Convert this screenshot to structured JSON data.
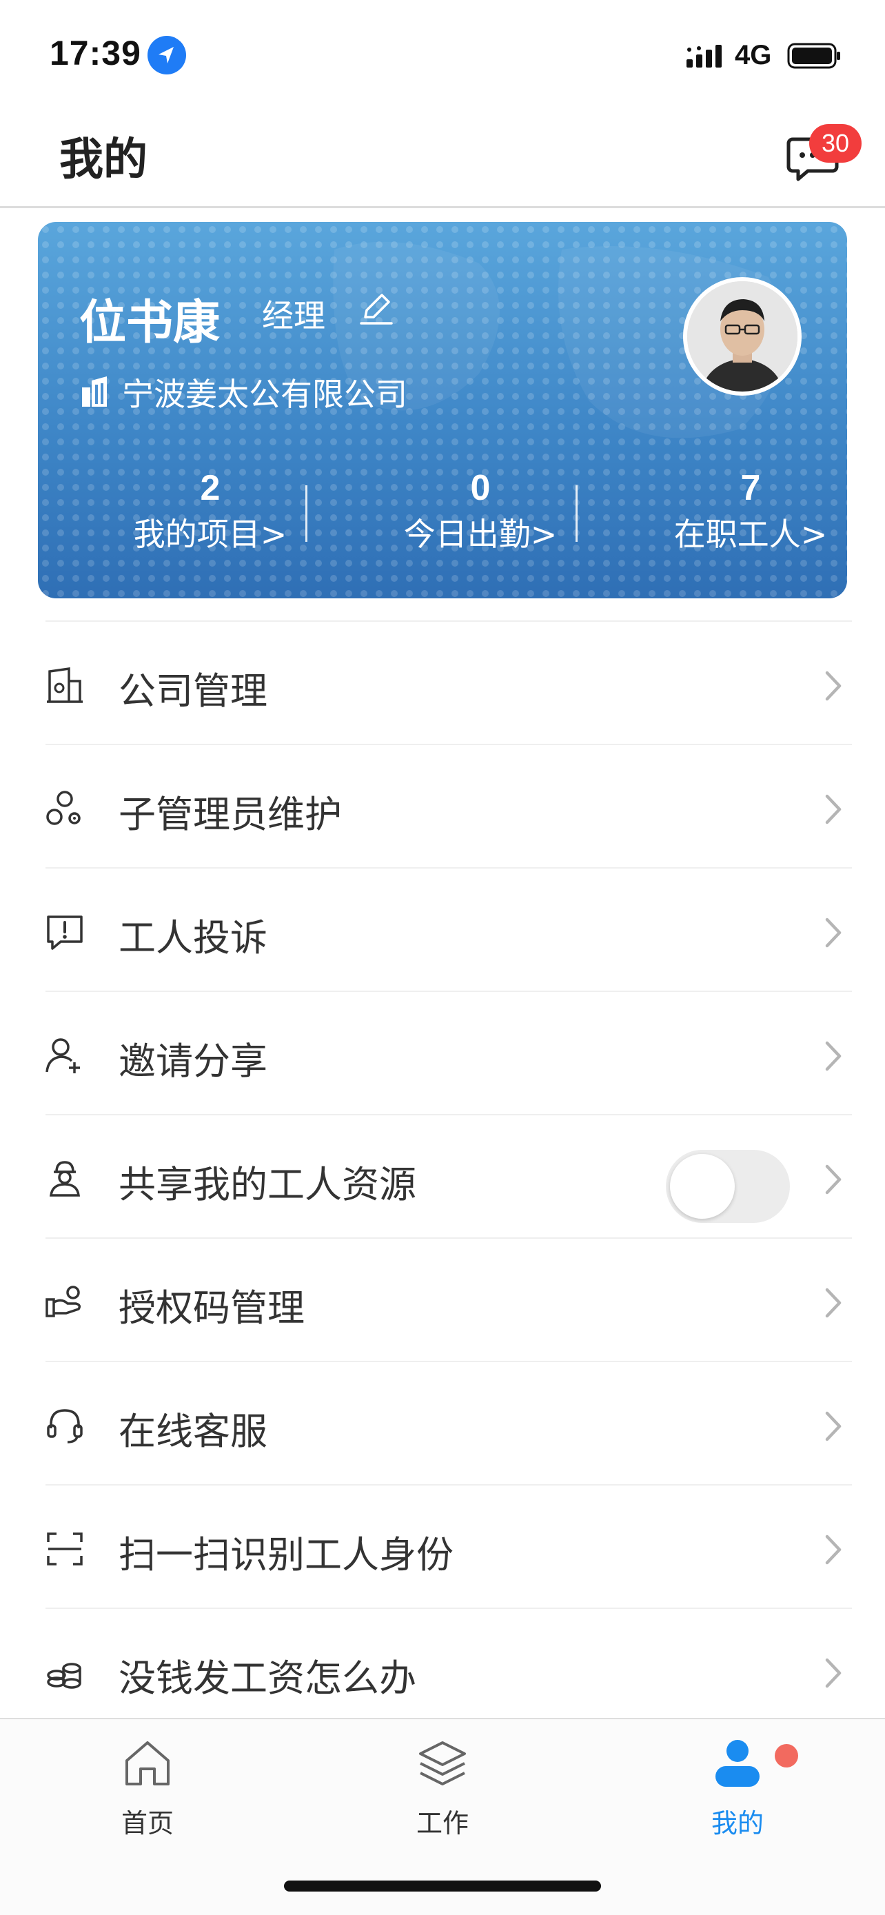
{
  "status_bar": {
    "time": "17:39",
    "network": "4G",
    "icons": [
      "location-arrow-icon",
      "signal-icon",
      "battery-icon"
    ]
  },
  "header": {
    "title": "我的",
    "message_badge": "30",
    "message_icon": "chat-bubble-icon"
  },
  "profile": {
    "name": "位书康",
    "role": "经理",
    "company": "宁波姜太公有限公司",
    "stats": [
      {
        "value": "2",
        "label": "我的项目>"
      },
      {
        "value": "0",
        "label": "今日出勤>"
      },
      {
        "value": "7",
        "label": "在职工人>"
      }
    ]
  },
  "menu": {
    "items": [
      {
        "label": "公司管理",
        "icon": "company-building-icon"
      },
      {
        "label": "子管理员维护",
        "icon": "sub-admin-icon"
      },
      {
        "label": "工人投诉",
        "icon": "complaint-icon"
      },
      {
        "label": "邀请分享",
        "icon": "invite-user-icon"
      },
      {
        "label": "共享我的工人资源",
        "icon": "share-worker-icon",
        "toggle": false
      },
      {
        "label": "授权码管理",
        "icon": "auth-code-icon"
      },
      {
        "label": "在线客服",
        "icon": "headset-icon"
      },
      {
        "label": "扫一扫识别工人身份",
        "icon": "scan-icon"
      },
      {
        "label": "没钱发工资怎么办",
        "icon": "coins-icon"
      }
    ]
  },
  "tabs": [
    {
      "label": "首页",
      "icon": "home-icon",
      "active": false
    },
    {
      "label": "工作",
      "icon": "layers-icon",
      "active": false
    },
    {
      "label": "我的",
      "icon": "profile-icon",
      "active": true
    }
  ],
  "colors": {
    "accent": "#1a8cf0",
    "badge": "#f23d3d",
    "card_top": "#5aa6dc",
    "card_bottom": "#2f6fb5"
  }
}
